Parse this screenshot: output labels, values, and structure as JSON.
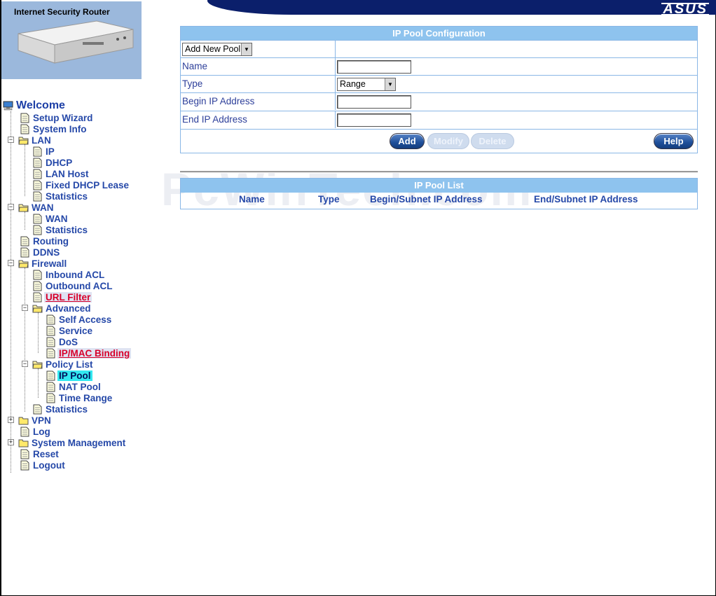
{
  "header": {
    "product_title": "Internet Security Router",
    "brand": "ASUS"
  },
  "tree": {
    "welcome": "Welcome",
    "items": {
      "setup_wizard": "Setup Wizard",
      "system_info": "System Info",
      "lan": "LAN",
      "lan_ip": "IP",
      "lan_dhcp": "DHCP",
      "lan_host": "LAN Host",
      "fixed_dhcp": "Fixed DHCP Lease",
      "lan_stats": "Statistics",
      "wan": "WAN",
      "wan_wan": "WAN",
      "wan_stats": "Statistics",
      "routing": "Routing",
      "ddns": "DDNS",
      "firewall": "Firewall",
      "inbound_acl": "Inbound ACL",
      "outbound_acl": "Outbound ACL",
      "url_filter": "URL Filter",
      "advanced": "Advanced",
      "self_access": "Self Access",
      "service": "Service",
      "dos": "DoS",
      "ip_mac_binding": "IP/MAC Binding",
      "policy_list": "Policy List",
      "ip_pool": "IP Pool",
      "nat_pool": "NAT Pool",
      "time_range": "Time Range",
      "fw_stats": "Statistics",
      "vpn": "VPN",
      "log": "Log",
      "system_management": "System Management",
      "reset": "Reset",
      "logout": "Logout"
    },
    "selected_color": "#33e8f0",
    "visited_color": "#d8002a"
  },
  "config": {
    "title": "IP Pool Configuration",
    "pool_select": "Add New Pool",
    "labels": {
      "name": "Name",
      "type": "Type",
      "begin_ip": "Begin IP Address",
      "end_ip": "End IP Address"
    },
    "values": {
      "name": "",
      "type": "Range",
      "begin_ip": "",
      "end_ip": ""
    },
    "buttons": {
      "add": "Add",
      "modify": "Modify",
      "delete": "Delete",
      "help": "Help"
    }
  },
  "list": {
    "title": "IP Pool List",
    "columns": [
      "Name",
      "Type",
      "Begin/Subnet IP Address",
      "End/Subnet IP Address"
    ]
  },
  "watermark": "PcWinTech.com"
}
